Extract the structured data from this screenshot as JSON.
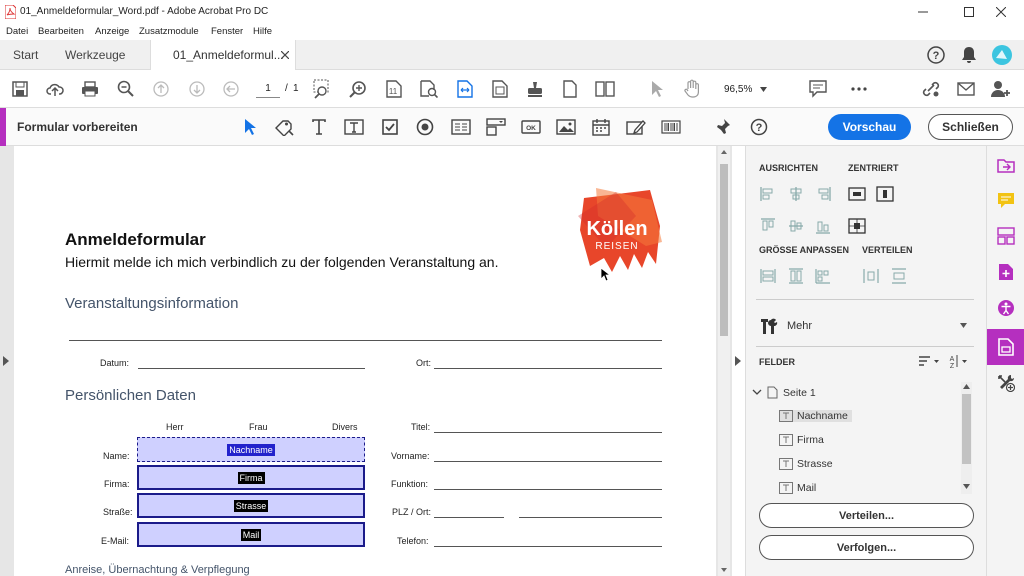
{
  "window": {
    "title": "01_Anmeldeformular_Word.pdf - Adobe Acrobat Pro DC"
  },
  "menu": [
    "Datei",
    "Bearbeiten",
    "Anzeige",
    "Zusatzmodule",
    "Fenster",
    "Hilfe"
  ],
  "tabs": {
    "start": "Start",
    "tools": "Werkzeuge",
    "document": "01_Anmeldeformul..."
  },
  "toolbar": {
    "page_current": "1",
    "page_sep": "/",
    "page_total": "1",
    "zoom": "96,5%"
  },
  "formbar": {
    "title": "Formular vorbereiten",
    "preview": "Vorschau",
    "close": "Schließen"
  },
  "document": {
    "logo_line1": "Köllen",
    "logo_line2": "REISEN",
    "heading": "Anmeldeformular",
    "subheading": "Hiermit melde ich mich verbindlich zu der folgenden Veranstaltung an.",
    "section1": "Veranstaltungsinformation",
    "datum": "Datum:",
    "ort": "Ort:",
    "section2": "Persönlichen Daten",
    "herr": "Herr",
    "frau": "Frau",
    "divers": "Divers",
    "titel": "Titel:",
    "name": "Name:",
    "vorname": "Vorname:",
    "firma": "Firma:",
    "funktion": "Funktion:",
    "strasse": "Straße:",
    "plz": "PLZ / Ort:",
    "email": "E-Mail:",
    "telefon": "Telefon:",
    "section3": "Anreise, Übernachtung & Verpflegung",
    "fields": {
      "nachname": "Nachname",
      "firma": "Firma",
      "strasse": "Strasse",
      "mail": "Mail"
    }
  },
  "panel": {
    "ausrichten": "AUSRICHTEN",
    "zentriert": "ZENTRIERT",
    "groesse": "GRÖSSE ANPASSEN",
    "verteilen": "VERTEILEN",
    "mehr": "Mehr",
    "felder": "FELDER",
    "seite": "Seite 1",
    "items": [
      "Nachname",
      "Firma",
      "Strasse",
      "Mail"
    ],
    "btn_verteilen": "Verteilen...",
    "btn_verfolgen": "Verfolgen..."
  },
  "colors": {
    "accent": "#b52fbf",
    "primary": "#1473e6",
    "field_fill": "#cfd0ff",
    "field_border": "#1b1b8a",
    "logo": "#e8462a"
  }
}
